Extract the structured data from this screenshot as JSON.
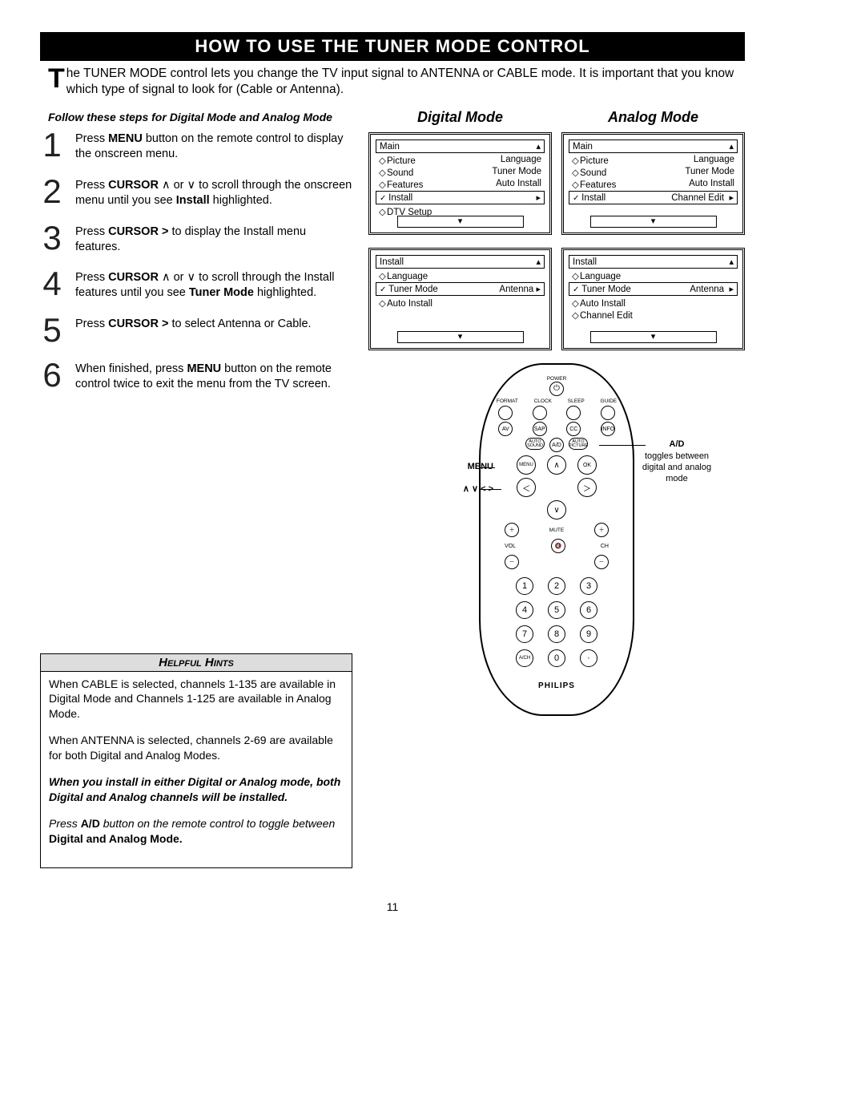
{
  "title": "HOW TO USE THE TUNER MODE CONTROL",
  "intro_cap": "T",
  "intro": "he TUNER MODE control lets you change the TV input signal to ANTENNA or CABLE mode. It is important that you know which type of signal to look for (Cable or Antenna).",
  "follow": "Follow these steps for Digital Mode and Analog Mode",
  "mode_digital": "Digital Mode",
  "mode_analog": "Analog Mode",
  "steps": {
    "s1": {
      "num": "1",
      "pre": "Press ",
      "b": "MENU",
      "post": " button on the remote control to display the onscreen menu."
    },
    "s2": {
      "num": "2",
      "pre": "Press ",
      "b": "CURSOR",
      "mid": " ∧ or ∨ to scroll through the onscreen menu until you see ",
      "b2": "Install",
      "post2": " highlighted."
    },
    "s3": {
      "num": "3",
      "pre": "Press ",
      "b": "CURSOR  >",
      "post": "  to display the Install menu features."
    },
    "s4": {
      "num": "4",
      "pre": "Press ",
      "b": "CURSOR",
      "mid": " ∧ or ∨ to scroll through the Install features until you see ",
      "b2": "Tuner Mode",
      "post2": " highlighted."
    },
    "s5": {
      "num": "5",
      "pre": "Press ",
      "b": "CURSOR >",
      "post": "  to select Antenna or Cable."
    },
    "s6": {
      "num": "6",
      "pre": "When finished, press ",
      "b": "MENU",
      "post": " button on the remote control twice to exit the menu from the TV screen."
    }
  },
  "panel": {
    "main": "Main",
    "picture": "Picture",
    "language": "Language",
    "sound": "Sound",
    "tuner_mode": "Tuner Mode",
    "features": "Features",
    "auto_install": "Auto Install",
    "install": "Install",
    "channel_edit": "Channel Edit",
    "dtv_setup": "DTV Setup",
    "antenna": "Antenna"
  },
  "remote": {
    "power": "POWER",
    "r1": [
      "FORMAT",
      "CLOCK",
      "SLEEP",
      "GUIDE"
    ],
    "r2": [
      "AV",
      "SAP",
      "CC",
      "INFO"
    ],
    "r3": [
      "AUTO SOUND",
      "A/D",
      "AUTO PICTURE"
    ],
    "menu": "MENU",
    "ok": "OK",
    "mute": "MUTE",
    "vol": "VOL",
    "ch": "CH",
    "ach": "A/CH",
    "brand": "PHILIPS"
  },
  "callout": {
    "menu": "MENU",
    "arrows": "∧ ∨ < >",
    "ad_h": "A/D",
    "ad_t": "toggles between digital and analog mode"
  },
  "hints": {
    "title": "Helpful Hints",
    "p1": "When CABLE is selected, channels 1-135 are available in Digital Mode and Channels 1-125 are available in Analog Mode.",
    "p2": "When ANTENNA is selected, channels 2-69 are available for both Digital and Analog Modes.",
    "p3": "When you install in either Digital or Analog mode, both Digital and Analog channels will be installed.",
    "p4a": "Press ",
    "p4b": "A/D",
    "p4c": " button on the remote control to toggle between ",
    "p4d": "Digital and Analog Mode."
  },
  "pagenum": "11"
}
